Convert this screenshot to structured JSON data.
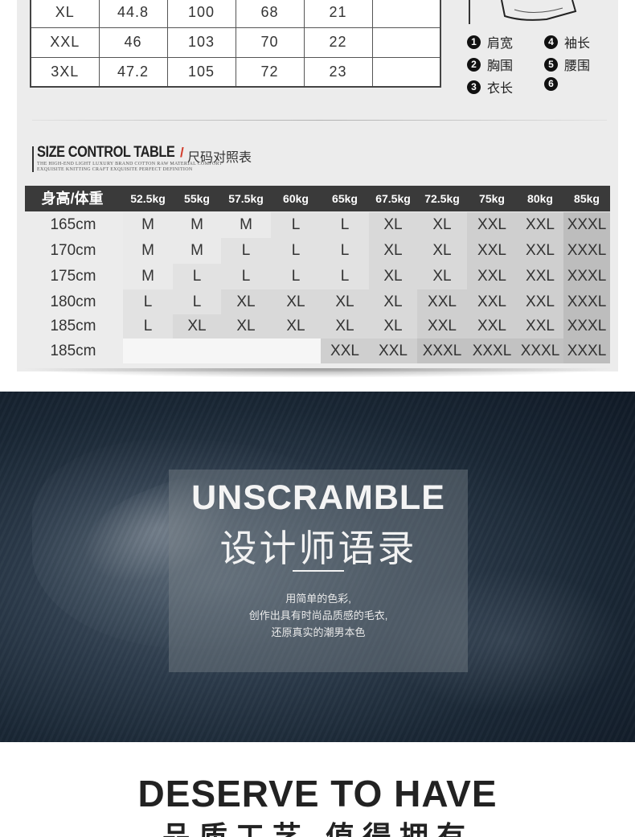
{
  "measure_table": {
    "rows": [
      [
        "XL",
        "44.8",
        "100",
        "68",
        "21",
        ""
      ],
      [
        "XXL",
        "46",
        "103",
        "70",
        "22",
        ""
      ],
      [
        "3XL",
        "47.2",
        "105",
        "72",
        "23",
        ""
      ]
    ]
  },
  "legend": {
    "items": [
      {
        "num": "1",
        "label": "肩宽"
      },
      {
        "num": "4",
        "label": "袖长"
      },
      {
        "num": "2",
        "label": "胸围"
      },
      {
        "num": "5",
        "label": "腰围"
      },
      {
        "num": "3",
        "label": "衣长"
      },
      {
        "num": "6",
        "label": ""
      }
    ]
  },
  "size_control": {
    "title": "SIZE CONTROL TABLE",
    "slash": "/",
    "title_cn": "尺码对照表",
    "subtitle_line1": "THE HIGH-END LIGHT LUXURY BRAND COTTON RAW MATERIAL COMFORT",
    "subtitle_line2": "EXQUISITE KNITTING CRAFT EXQUISITE PERFECT DEFINITION"
  },
  "size_grid": {
    "corner": "身高/体重",
    "weights": [
      "52.5kg",
      "55kg",
      "57.5kg",
      "60kg",
      "65kg",
      "67.5kg",
      "72.5kg",
      "75kg",
      "80kg",
      "85kg"
    ],
    "heights": [
      "165cm",
      "170cm",
      "175cm",
      "180cm",
      "185cm",
      "185cm"
    ],
    "cells": [
      [
        "M",
        "M",
        "M",
        "L",
        "L",
        "XL",
        "XL",
        "XXL",
        "XXL",
        "XXXL"
      ],
      [
        "M",
        "M",
        "L",
        "L",
        "L",
        "XL",
        "XL",
        "XXL",
        "XXL",
        "XXXL"
      ],
      [
        "M",
        "L",
        "L",
        "L",
        "L",
        "XL",
        "XL",
        "XXL",
        "XXL",
        "XXXL"
      ],
      [
        "L",
        "L",
        "XL",
        "XL",
        "XL",
        "XL",
        "XXL",
        "XXL",
        "XXL",
        "XXXL"
      ],
      [
        "L",
        "XL",
        "XL",
        "XL",
        "XL",
        "XL",
        "XXL",
        "XXL",
        "XXL",
        "XXXL"
      ],
      [
        "",
        "",
        "",
        "",
        "XXL",
        "XXL",
        "XXXL",
        "XXXL",
        "XXXL",
        "XXXL"
      ]
    ]
  },
  "unscramble": {
    "title": "UNSCRAMBLE",
    "title_cn": "设计师语录",
    "line1": "用简单的色彩,",
    "line2": "创作出具有时尚品质感的毛衣,",
    "line3": "还原真实的潮男本色"
  },
  "deserve": {
    "title": "DESERVE TO HAVE",
    "title_cn": "品质工艺 值得拥有"
  },
  "colors": {
    "panel": "#ececec",
    "grid_header": "#3a3a3a",
    "accent_red": "#d23b2a",
    "dark_band": "#1f2d3c"
  }
}
